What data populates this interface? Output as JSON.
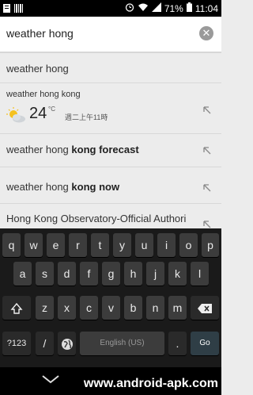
{
  "status": {
    "battery": "71%",
    "time": "11:04"
  },
  "search": {
    "query": "weather hong"
  },
  "suggestions": [
    {
      "text": "weather hong"
    },
    {
      "title": "weather hong kong",
      "temp": "24",
      "unit": "°C",
      "time": "週二上午11時"
    },
    {
      "prefix": "weather hong ",
      "bold": "kong forecast"
    },
    {
      "prefix": "weather hong ",
      "bold": "kong now"
    },
    {
      "text": "Hong Kong Observatory-Official Authori"
    }
  ],
  "keyboard": {
    "row1": [
      "q",
      "w",
      "e",
      "r",
      "t",
      "y",
      "u",
      "i",
      "o",
      "p"
    ],
    "row2": [
      "a",
      "s",
      "d",
      "f",
      "g",
      "h",
      "j",
      "k",
      "l"
    ],
    "row3": [
      "z",
      "x",
      "c",
      "v",
      "b",
      "n",
      "m"
    ],
    "symbols_label": "?123",
    "slash": "/",
    "space_label": "English (US)",
    "period": ".",
    "go_label": "Go"
  },
  "watermark": "www.android-apk.com",
  "icons": [
    "notification-icon",
    "alarm-icon",
    "wifi-icon",
    "signal-icon",
    "battery-icon",
    "clear-icon",
    "arrow-icon",
    "sun-cloud-icon",
    "shift-icon",
    "backspace-icon",
    "globe-icon",
    "chevron-down-icon"
  ]
}
